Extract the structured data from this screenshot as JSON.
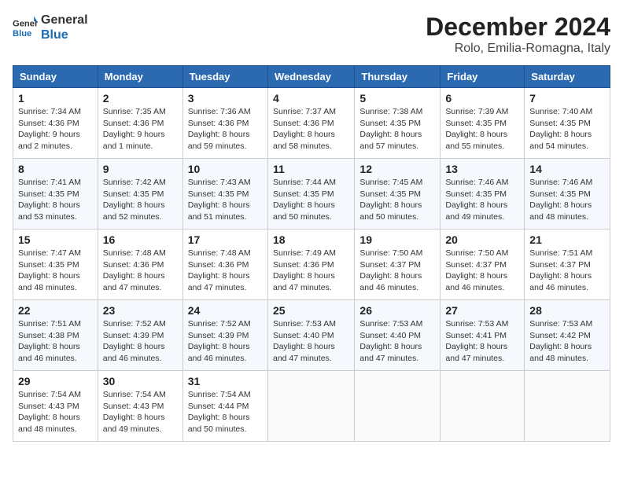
{
  "logo": {
    "line1": "General",
    "line2": "Blue"
  },
  "title": "December 2024",
  "location": "Rolo, Emilia-Romagna, Italy",
  "weekdays": [
    "Sunday",
    "Monday",
    "Tuesday",
    "Wednesday",
    "Thursday",
    "Friday",
    "Saturday"
  ],
  "weeks": [
    [
      {
        "day": 1,
        "sunrise": "7:34 AM",
        "sunset": "4:36 PM",
        "daylight": "9 hours and 2 minutes."
      },
      {
        "day": 2,
        "sunrise": "7:35 AM",
        "sunset": "4:36 PM",
        "daylight": "9 hours and 1 minute."
      },
      {
        "day": 3,
        "sunrise": "7:36 AM",
        "sunset": "4:36 PM",
        "daylight": "8 hours and 59 minutes."
      },
      {
        "day": 4,
        "sunrise": "7:37 AM",
        "sunset": "4:36 PM",
        "daylight": "8 hours and 58 minutes."
      },
      {
        "day": 5,
        "sunrise": "7:38 AM",
        "sunset": "4:35 PM",
        "daylight": "8 hours and 57 minutes."
      },
      {
        "day": 6,
        "sunrise": "7:39 AM",
        "sunset": "4:35 PM",
        "daylight": "8 hours and 55 minutes."
      },
      {
        "day": 7,
        "sunrise": "7:40 AM",
        "sunset": "4:35 PM",
        "daylight": "8 hours and 54 minutes."
      }
    ],
    [
      {
        "day": 8,
        "sunrise": "7:41 AM",
        "sunset": "4:35 PM",
        "daylight": "8 hours and 53 minutes."
      },
      {
        "day": 9,
        "sunrise": "7:42 AM",
        "sunset": "4:35 PM",
        "daylight": "8 hours and 52 minutes."
      },
      {
        "day": 10,
        "sunrise": "7:43 AM",
        "sunset": "4:35 PM",
        "daylight": "8 hours and 51 minutes."
      },
      {
        "day": 11,
        "sunrise": "7:44 AM",
        "sunset": "4:35 PM",
        "daylight": "8 hours and 50 minutes."
      },
      {
        "day": 12,
        "sunrise": "7:45 AM",
        "sunset": "4:35 PM",
        "daylight": "8 hours and 50 minutes."
      },
      {
        "day": 13,
        "sunrise": "7:46 AM",
        "sunset": "4:35 PM",
        "daylight": "8 hours and 49 minutes."
      },
      {
        "day": 14,
        "sunrise": "7:46 AM",
        "sunset": "4:35 PM",
        "daylight": "8 hours and 48 minutes."
      }
    ],
    [
      {
        "day": 15,
        "sunrise": "7:47 AM",
        "sunset": "4:35 PM",
        "daylight": "8 hours and 48 minutes."
      },
      {
        "day": 16,
        "sunrise": "7:48 AM",
        "sunset": "4:36 PM",
        "daylight": "8 hours and 47 minutes."
      },
      {
        "day": 17,
        "sunrise": "7:48 AM",
        "sunset": "4:36 PM",
        "daylight": "8 hours and 47 minutes."
      },
      {
        "day": 18,
        "sunrise": "7:49 AM",
        "sunset": "4:36 PM",
        "daylight": "8 hours and 47 minutes."
      },
      {
        "day": 19,
        "sunrise": "7:50 AM",
        "sunset": "4:37 PM",
        "daylight": "8 hours and 46 minutes."
      },
      {
        "day": 20,
        "sunrise": "7:50 AM",
        "sunset": "4:37 PM",
        "daylight": "8 hours and 46 minutes."
      },
      {
        "day": 21,
        "sunrise": "7:51 AM",
        "sunset": "4:37 PM",
        "daylight": "8 hours and 46 minutes."
      }
    ],
    [
      {
        "day": 22,
        "sunrise": "7:51 AM",
        "sunset": "4:38 PM",
        "daylight": "8 hours and 46 minutes."
      },
      {
        "day": 23,
        "sunrise": "7:52 AM",
        "sunset": "4:39 PM",
        "daylight": "8 hours and 46 minutes."
      },
      {
        "day": 24,
        "sunrise": "7:52 AM",
        "sunset": "4:39 PM",
        "daylight": "8 hours and 46 minutes."
      },
      {
        "day": 25,
        "sunrise": "7:53 AM",
        "sunset": "4:40 PM",
        "daylight": "8 hours and 47 minutes."
      },
      {
        "day": 26,
        "sunrise": "7:53 AM",
        "sunset": "4:40 PM",
        "daylight": "8 hours and 47 minutes."
      },
      {
        "day": 27,
        "sunrise": "7:53 AM",
        "sunset": "4:41 PM",
        "daylight": "8 hours and 47 minutes."
      },
      {
        "day": 28,
        "sunrise": "7:53 AM",
        "sunset": "4:42 PM",
        "daylight": "8 hours and 48 minutes."
      }
    ],
    [
      {
        "day": 29,
        "sunrise": "7:54 AM",
        "sunset": "4:43 PM",
        "daylight": "8 hours and 48 minutes."
      },
      {
        "day": 30,
        "sunrise": "7:54 AM",
        "sunset": "4:43 PM",
        "daylight": "8 hours and 49 minutes."
      },
      {
        "day": 31,
        "sunrise": "7:54 AM",
        "sunset": "4:44 PM",
        "daylight": "8 hours and 50 minutes."
      },
      null,
      null,
      null,
      null
    ]
  ],
  "labels": {
    "sunrise": "Sunrise: ",
    "sunset": "Sunset: ",
    "daylight": "Daylight: "
  }
}
